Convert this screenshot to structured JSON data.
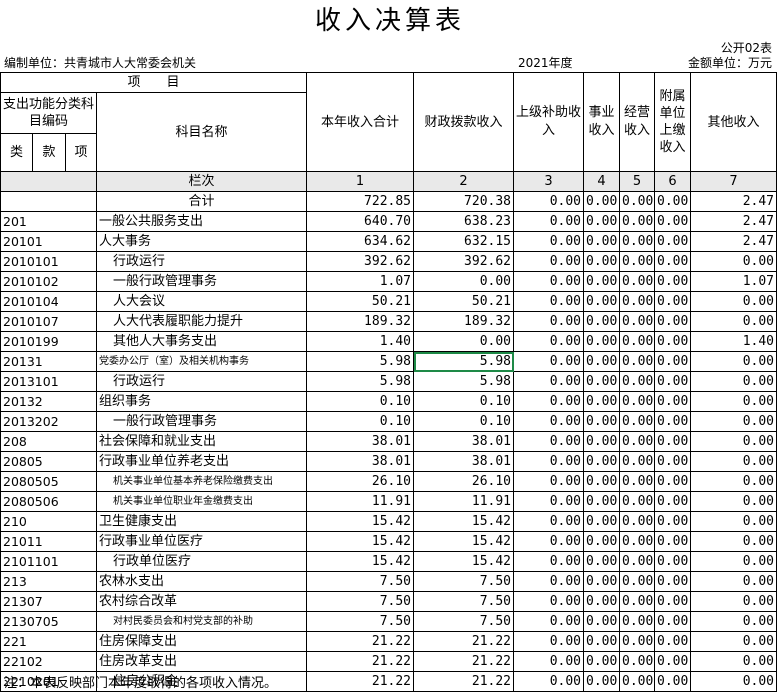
{
  "title": "收入决算表",
  "form_code": "公开02表",
  "unit_label": "编制单位：共青城市人大常委会机关",
  "year": "2021年度",
  "amount_unit": "金额单位：万元",
  "headers": {
    "item": "项　　目",
    "func_code": "支出功能分类科目编码",
    "subject_name": "科目名称",
    "lei": "类",
    "kuan": "款",
    "xiang": "项",
    "lanci": "栏次",
    "heji": "合计",
    "cols": [
      "本年收入合计",
      "财政拨款收入",
      "上级补助收入",
      "事业收入",
      "经营收入",
      "附属单位上缴收入",
      "其他收入"
    ],
    "col_nums": [
      "1",
      "2",
      "3",
      "4",
      "5",
      "6",
      "7"
    ]
  },
  "total": [
    "722.85",
    "720.38",
    "0.00",
    "0.00",
    "0.00",
    "0.00",
    "2.47"
  ],
  "rows": [
    {
      "code": "201",
      "name": "一般公共服务支出",
      "vals": [
        "640.70",
        "638.23",
        "0.00",
        "0.00",
        "0.00",
        "0.00",
        "2.47"
      ]
    },
    {
      "code": "20101",
      "name": "人大事务",
      "vals": [
        "634.62",
        "632.15",
        "0.00",
        "0.00",
        "0.00",
        "0.00",
        "2.47"
      ]
    },
    {
      "code": "2010101",
      "name": "行政运行",
      "vals": [
        "392.62",
        "392.62",
        "0.00",
        "0.00",
        "0.00",
        "0.00",
        "0.00"
      ]
    },
    {
      "code": "2010102",
      "name": "一般行政管理事务",
      "vals": [
        "1.07",
        "0.00",
        "0.00",
        "0.00",
        "0.00",
        "0.00",
        "1.07"
      ]
    },
    {
      "code": "2010104",
      "name": "人大会议",
      "vals": [
        "50.21",
        "50.21",
        "0.00",
        "0.00",
        "0.00",
        "0.00",
        "0.00"
      ]
    },
    {
      "code": "2010107",
      "name": "人大代表履职能力提升",
      "vals": [
        "189.32",
        "189.32",
        "0.00",
        "0.00",
        "0.00",
        "0.00",
        "0.00"
      ]
    },
    {
      "code": "2010199",
      "name": "其他人大事务支出",
      "vals": [
        "1.40",
        "0.00",
        "0.00",
        "0.00",
        "0.00",
        "0.00",
        "1.40"
      ]
    },
    {
      "code": "20131",
      "name": "党委办公厅（室）及相关机构事务",
      "vals": [
        "5.98",
        "5.98",
        "0.00",
        "0.00",
        "0.00",
        "0.00",
        "0.00"
      ]
    },
    {
      "code": "2013101",
      "name": "行政运行",
      "vals": [
        "5.98",
        "5.98",
        "0.00",
        "0.00",
        "0.00",
        "0.00",
        "0.00"
      ]
    },
    {
      "code": "20132",
      "name": "组织事务",
      "vals": [
        "0.10",
        "0.10",
        "0.00",
        "0.00",
        "0.00",
        "0.00",
        "0.00"
      ]
    },
    {
      "code": "2013202",
      "name": "一般行政管理事务",
      "vals": [
        "0.10",
        "0.10",
        "0.00",
        "0.00",
        "0.00",
        "0.00",
        "0.00"
      ]
    },
    {
      "code": "208",
      "name": "社会保障和就业支出",
      "vals": [
        "38.01",
        "38.01",
        "0.00",
        "0.00",
        "0.00",
        "0.00",
        "0.00"
      ]
    },
    {
      "code": "20805",
      "name": "行政事业单位养老支出",
      "vals": [
        "38.01",
        "38.01",
        "0.00",
        "0.00",
        "0.00",
        "0.00",
        "0.00"
      ]
    },
    {
      "code": "2080505",
      "name": "机关事业单位基本养老保险缴费支出",
      "vals": [
        "26.10",
        "26.10",
        "0.00",
        "0.00",
        "0.00",
        "0.00",
        "0.00"
      ]
    },
    {
      "code": "2080506",
      "name": "机关事业单位职业年金缴费支出",
      "vals": [
        "11.91",
        "11.91",
        "0.00",
        "0.00",
        "0.00",
        "0.00",
        "0.00"
      ]
    },
    {
      "code": "210",
      "name": "卫生健康支出",
      "vals": [
        "15.42",
        "15.42",
        "0.00",
        "0.00",
        "0.00",
        "0.00",
        "0.00"
      ]
    },
    {
      "code": "21011",
      "name": "行政事业单位医疗",
      "vals": [
        "15.42",
        "15.42",
        "0.00",
        "0.00",
        "0.00",
        "0.00",
        "0.00"
      ]
    },
    {
      "code": "2101101",
      "name": "行政单位医疗",
      "vals": [
        "15.42",
        "15.42",
        "0.00",
        "0.00",
        "0.00",
        "0.00",
        "0.00"
      ]
    },
    {
      "code": "213",
      "name": "农林水支出",
      "vals": [
        "7.50",
        "7.50",
        "0.00",
        "0.00",
        "0.00",
        "0.00",
        "0.00"
      ]
    },
    {
      "code": "21307",
      "name": "农村综合改革",
      "vals": [
        "7.50",
        "7.50",
        "0.00",
        "0.00",
        "0.00",
        "0.00",
        "0.00"
      ]
    },
    {
      "code": "2130705",
      "name": "对村民委员会和村党支部的补助",
      "vals": [
        "7.50",
        "7.50",
        "0.00",
        "0.00",
        "0.00",
        "0.00",
        "0.00"
      ]
    },
    {
      "code": "221",
      "name": "住房保障支出",
      "vals": [
        "21.22",
        "21.22",
        "0.00",
        "0.00",
        "0.00",
        "0.00",
        "0.00"
      ]
    },
    {
      "code": "22102",
      "name": "住房改革支出",
      "vals": [
        "21.22",
        "21.22",
        "0.00",
        "0.00",
        "0.00",
        "0.00",
        "0.00"
      ]
    },
    {
      "code": "2210201",
      "name": "住房公积金",
      "vals": [
        "21.22",
        "21.22",
        "0.00",
        "0.00",
        "0.00",
        "0.00",
        "0.00"
      ]
    }
  ],
  "note": "注：本表反映部门本年度取得的各项收入情况。"
}
